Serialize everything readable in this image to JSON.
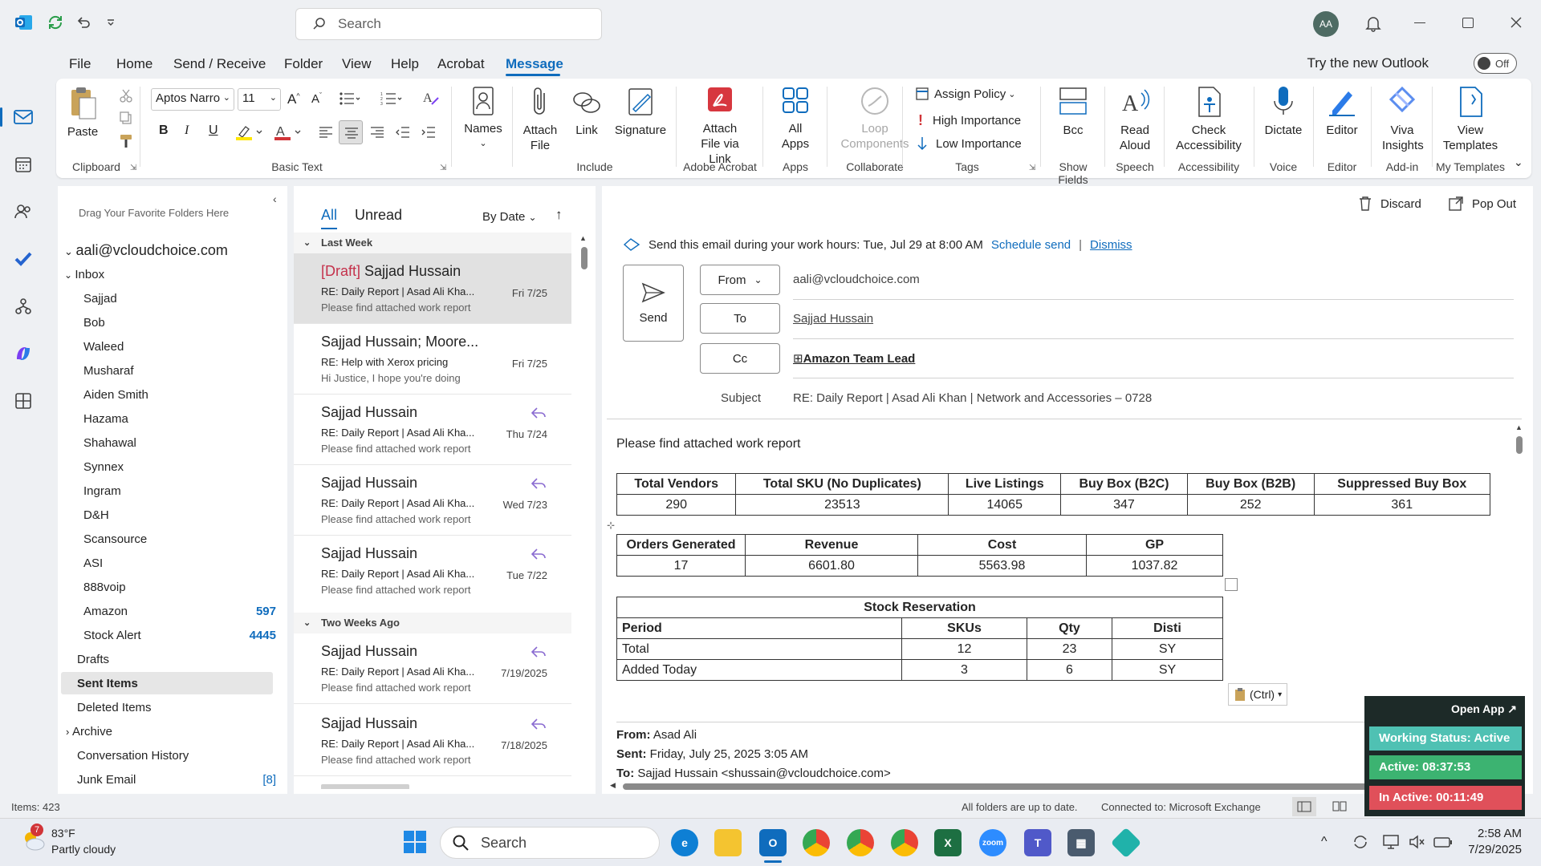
{
  "titlebar": {
    "search_placeholder": "Search",
    "avatar_initials": "AA"
  },
  "menu": {
    "tabs": [
      "File",
      "Home",
      "Send / Receive",
      "Folder",
      "View",
      "Help",
      "Acrobat",
      "Message"
    ],
    "active_tab": "Message",
    "try_new": "Try the new Outlook",
    "toggle_label": "Off"
  },
  "ribbon": {
    "paste": "Paste",
    "font_name": "Aptos Narro",
    "font_size": "11",
    "names": "Names",
    "attach_file": "Attach File",
    "link": "Link",
    "signature": "Signature",
    "attach_via_link": "Attach File via Link",
    "all_apps": "All Apps",
    "loop_components": "Loop Components",
    "assign_policy": "Assign Policy",
    "high_importance": "High Importance",
    "low_importance": "Low Importance",
    "bcc": "Bcc",
    "read_aloud": "Read Aloud",
    "check_accessibility": "Check Accessibility",
    "dictate": "Dictate",
    "editor": "Editor",
    "viva_insights": "Viva Insights",
    "view_templates": "View Templates",
    "groups": {
      "clipboard": "Clipboard",
      "basic_text": "Basic Text",
      "include": "Include",
      "adobe_acrobat": "Adobe Acrobat",
      "apps": "Apps",
      "collaborate": "Collaborate",
      "tags": "Tags",
      "show_fields": "Show Fields",
      "speech": "Speech",
      "accessibility": "Accessibility",
      "voice": "Voice",
      "editor": "Editor",
      "add_in": "Add-in",
      "my_templates": "My Templates"
    }
  },
  "folders": {
    "drag_hint": "Drag Your Favorite Folders Here",
    "account": "aali@vcloudchoice.com",
    "inbox": "Inbox",
    "subfolders": [
      "Sajjad",
      "Bob",
      "Waleed",
      "Musharaf",
      "Aiden Smith",
      "Hazama",
      "Shahawal",
      "Synnex",
      "Ingram",
      "D&H",
      "Scansource",
      "ASI",
      "888voip"
    ],
    "amazon": "Amazon",
    "amazon_count": "597",
    "stock_alert": "Stock Alert",
    "stock_alert_count": "4445",
    "drafts": "Drafts",
    "sent_items": "Sent Items",
    "deleted_items": "Deleted Items",
    "archive": "Archive",
    "conversation_history": "Conversation History",
    "junk_email": "Junk Email",
    "junk_count": "[8]"
  },
  "msglist": {
    "tab_all": "All",
    "tab_unread": "Unread",
    "sort": "By Date",
    "group_last_week": "Last Week",
    "group_two_weeks": "Two Weeks Ago",
    "messages": [
      {
        "draft_tag": "[Draft]",
        "sender": " Sajjad Hussain",
        "subject": "RE: Daily Report | Asad Ali Kha...",
        "preview": "Please find attached work report",
        "date": "Fri 7/25"
      },
      {
        "draft_tag": "",
        "sender": "Sajjad Hussain; Moore...",
        "subject": "RE: Help with Xerox pricing",
        "preview": "Hi Justice,  I hope you're doing",
        "date": "Fri 7/25"
      },
      {
        "draft_tag": "",
        "sender": "Sajjad Hussain",
        "subject": "RE: Daily Report | Asad Ali Kha...",
        "preview": "Please find attached work report",
        "date": "Thu 7/24"
      },
      {
        "draft_tag": "",
        "sender": "Sajjad Hussain",
        "subject": "RE: Daily Report | Asad Ali Kha...",
        "preview": "Please find attached work report",
        "date": "Wed 7/23"
      },
      {
        "draft_tag": "",
        "sender": "Sajjad Hussain",
        "subject": "RE: Daily Report | Asad Ali Kha...",
        "preview": "Please find attached work report",
        "date": "Tue 7/22"
      },
      {
        "draft_tag": "",
        "sender": "Sajjad Hussain",
        "subject": "RE: Daily Report | Asad Ali Kha...",
        "preview": "Please find attached work report",
        "date": "7/19/2025"
      },
      {
        "draft_tag": "",
        "sender": "Sajjad Hussain",
        "subject": "RE: Daily Report | Asad Ali Kha...",
        "preview": "Please find attached work report",
        "date": "7/18/2025"
      }
    ]
  },
  "compose": {
    "discard": "Discard",
    "pop_out": "Pop Out",
    "schedule_msg": "Send this email during your work hours: Tue, Jul 29 at 8:00 AM",
    "schedule_send": "Schedule send",
    "dismiss": "Dismiss",
    "send": "Send",
    "from_label": "From",
    "from_value": "aali@vcloudchoice.com",
    "to_label": "To",
    "to_value": "Sajjad Hussain",
    "cc_label": "Cc",
    "cc_value": "Amazon Team Lead",
    "subject_label": "Subject",
    "subject_value": "RE: Daily Report | Asad Ali Khan | Network and Accessories – 0728",
    "body_intro": "Please find attached work report",
    "table1": {
      "headers": [
        "Total Vendors",
        "Total SKU (No Duplicates)",
        "Live Listings",
        "Buy Box (B2C)",
        "Buy Box (B2B)",
        "Suppressed Buy Box"
      ],
      "values": [
        "290",
        "23513",
        "14065",
        "347",
        "252",
        "361"
      ]
    },
    "table2": {
      "headers": [
        "Orders Generated",
        "Revenue",
        "Cost",
        "GP"
      ],
      "values": [
        "17",
        "6601.80",
        "5563.98",
        "1037.82"
      ]
    },
    "table3": {
      "title": "Stock Reservation",
      "headers": [
        "Period",
        "SKUs",
        "Qty",
        "Disti"
      ],
      "rows": [
        [
          "Total",
          "12",
          "23",
          "SY"
        ],
        [
          "Added Today",
          "3",
          "6",
          "SY"
        ]
      ]
    },
    "paste_ctrl": "(Ctrl)",
    "from_line_label": "From:",
    "from_line_value": " Asad Ali",
    "sent_line_label": "Sent:",
    "sent_line_value": " Friday, July 25, 2025 3:05 AM",
    "to_line_label": "To:",
    "to_line_value": " Sajjad Hussain <shussain@vcloudchoice.com>"
  },
  "widget": {
    "open_app": "Open App ↗",
    "working_status": "Working Status: Active",
    "active_time": "Active: 08:37:53",
    "inactive_time": "In Active: 00:11:49"
  },
  "status": {
    "items": "Items: 423",
    "folders_status": "All folders are up to date.",
    "connection": "Connected to: Microsoft Exchange"
  },
  "taskbar": {
    "temp": "83°F",
    "weather": "Partly cloudy",
    "weather_badge": "7",
    "search": "Search",
    "time": "2:58 AM",
    "date": "7/29/2025"
  },
  "colors": {
    "accent": "#0f6cbd",
    "draft": "#c4314b",
    "widget_green": "#3cb371",
    "widget_red": "#e0505a"
  }
}
